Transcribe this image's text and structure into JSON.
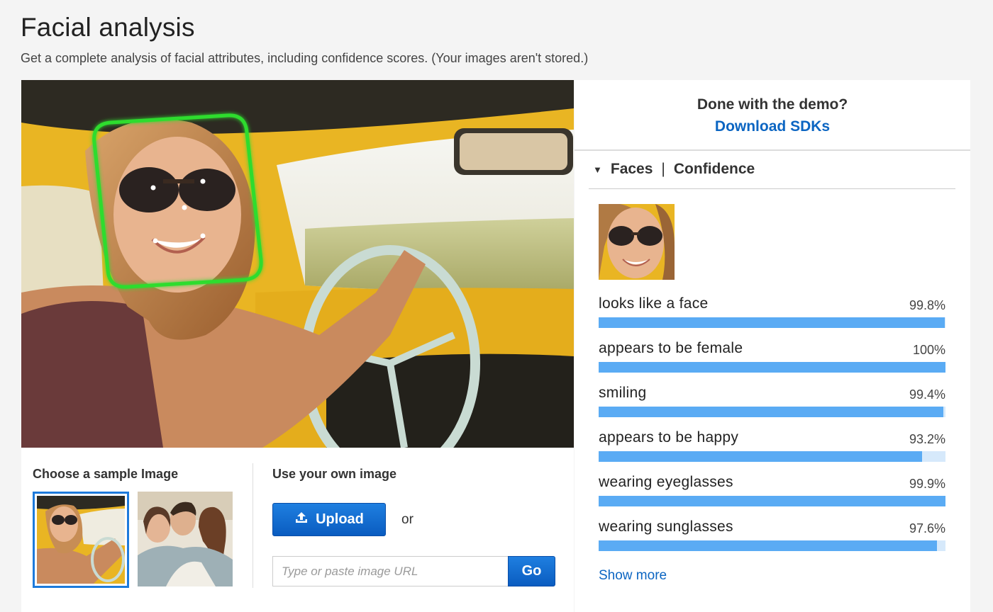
{
  "page": {
    "title": "Facial analysis",
    "subtitle": "Get a complete analysis of facial attributes, including confidence scores. (Your images aren't stored.)"
  },
  "left_bottom": {
    "sample_heading": "Choose a sample Image",
    "own_heading": "Use your own image",
    "upload_label": "Upload",
    "or_text": "or",
    "url_placeholder": "Type or paste image URL",
    "go_label": "Go"
  },
  "right_panel": {
    "demo_question": "Done with the demo?",
    "download_link": "Download SDKs",
    "faces_label": "Faces",
    "separator": "|",
    "confidence_label": "Confidence",
    "show_more": "Show more",
    "attributes": [
      {
        "label": "looks like a face",
        "value": "99.8%",
        "fraction": 0.998
      },
      {
        "label": "appears to be female",
        "value": "100%",
        "fraction": 1.0
      },
      {
        "label": "smiling",
        "value": "99.4%",
        "fraction": 0.994
      },
      {
        "label": "appears to be happy",
        "value": "93.2%",
        "fraction": 0.932
      },
      {
        "label": "wearing eyeglasses",
        "value": "99.9%",
        "fraction": 0.999
      },
      {
        "label": "wearing sunglasses",
        "value": "97.6%",
        "fraction": 0.976
      }
    ]
  },
  "colors": {
    "accent": "#0b65c2",
    "bar_fill": "#5aabf4",
    "bar_track": "#d6e9fb",
    "face_box": "#2edc2e",
    "selected_border": "#1d7adb"
  }
}
